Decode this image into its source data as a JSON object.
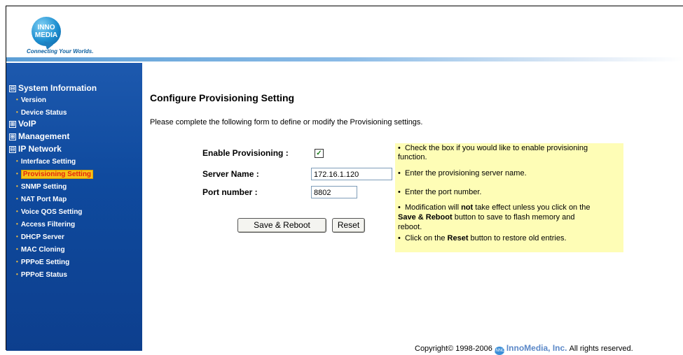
{
  "logo": {
    "line1": "INNO",
    "line2": "MEDIA",
    "tm": "™",
    "tagline": "Connecting Your Worlds."
  },
  "sidebar": {
    "groups": [
      {
        "symbol": "⊟",
        "label": "System Information"
      },
      {
        "symbol": "⊞",
        "label": "VoIP"
      },
      {
        "symbol": "⊞",
        "label": "Management"
      },
      {
        "symbol": "⊟",
        "label": "IP Network"
      }
    ],
    "system_items": [
      "Version",
      "Device Status"
    ],
    "ip_items": [
      "Interface Setting",
      "Provisioning Setting",
      "SNMP Setting",
      "NAT Port Map",
      "Voice QOS Setting",
      "Access Filtering",
      "DHCP Server",
      "MAC Cloning",
      "PPPoE Setting",
      "PPPoE Status"
    ],
    "bullet": "•"
  },
  "page": {
    "title": "Configure Provisioning Setting",
    "intro": "Please complete the following form to define or modify the Provisioning settings."
  },
  "form": {
    "enable_label": "Enable Provisioning :",
    "enable_checked": true,
    "check_glyph": "✓",
    "server_label": "Server Name :",
    "server_value": "172.16.1.120",
    "port_label": "Port number :",
    "port_value": "8802",
    "save_button": "Save & Reboot",
    "reset_button": "Reset"
  },
  "help": {
    "bullet": "•",
    "line1a": "Check the box if you would like to enable provisioning",
    "line1b": "function.",
    "line2": "Enter the provisioning server name.",
    "line3": "Enter the port number.",
    "line4a_pre": "Modification will ",
    "line4a_bold": "not",
    "line4a_post": " take effect unless you click on the",
    "line4b_bold": "Save & Reboot",
    "line4b_post": " button to save to flash memory and",
    "line4c": "reboot.",
    "line5_pre": "Click on the ",
    "line5_bold": "Reset",
    "line5_post": " button to restore old entries."
  },
  "footer": {
    "copyright": "Copyright© 1998-2006",
    "icon_text": "INNO",
    "brand": "InnoMedia, Inc.",
    "rights": "All rights reserved."
  },
  "colors": {
    "sidebar_bg": "#0f4a9e",
    "active_item_bg": "#f6c218",
    "active_item_text": "#e3260c",
    "help_bg": "#fefdb6",
    "brand": "#5b88c8"
  }
}
